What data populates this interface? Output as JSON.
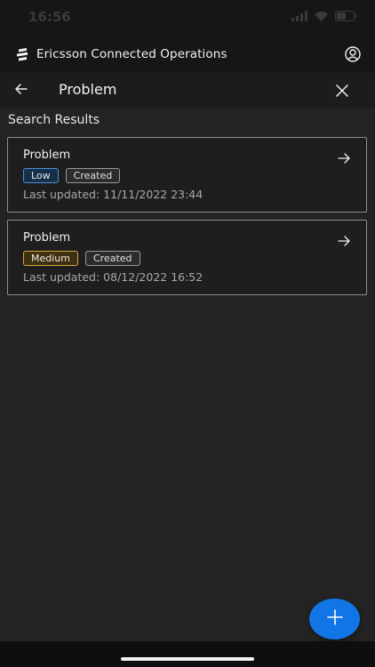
{
  "status_bar": {
    "time": "16:56"
  },
  "app_bar": {
    "brand_name": "Ericsson Connected Operations",
    "logo_icon": "ericsson-logo-icon",
    "profile_icon": "user-circle-icon"
  },
  "header": {
    "title": "Problem",
    "back_icon": "arrow-left-icon",
    "close_icon": "close-icon"
  },
  "results": {
    "heading": "Search Results",
    "items": [
      {
        "title": "Problem",
        "priority": "Low",
        "status": "Created",
        "updated": "Last updated: 11/11/2022 23:44"
      },
      {
        "title": "Problem",
        "priority": "Medium",
        "status": "Created",
        "updated": "Last updated: 08/12/2022 16:52"
      }
    ]
  },
  "fab": {
    "icon": "plus-icon"
  },
  "colors": {
    "accent": "#1175e6",
    "low_badge": "#4b8fd4",
    "medium_badge": "#d6a33a",
    "background": "#232323"
  }
}
